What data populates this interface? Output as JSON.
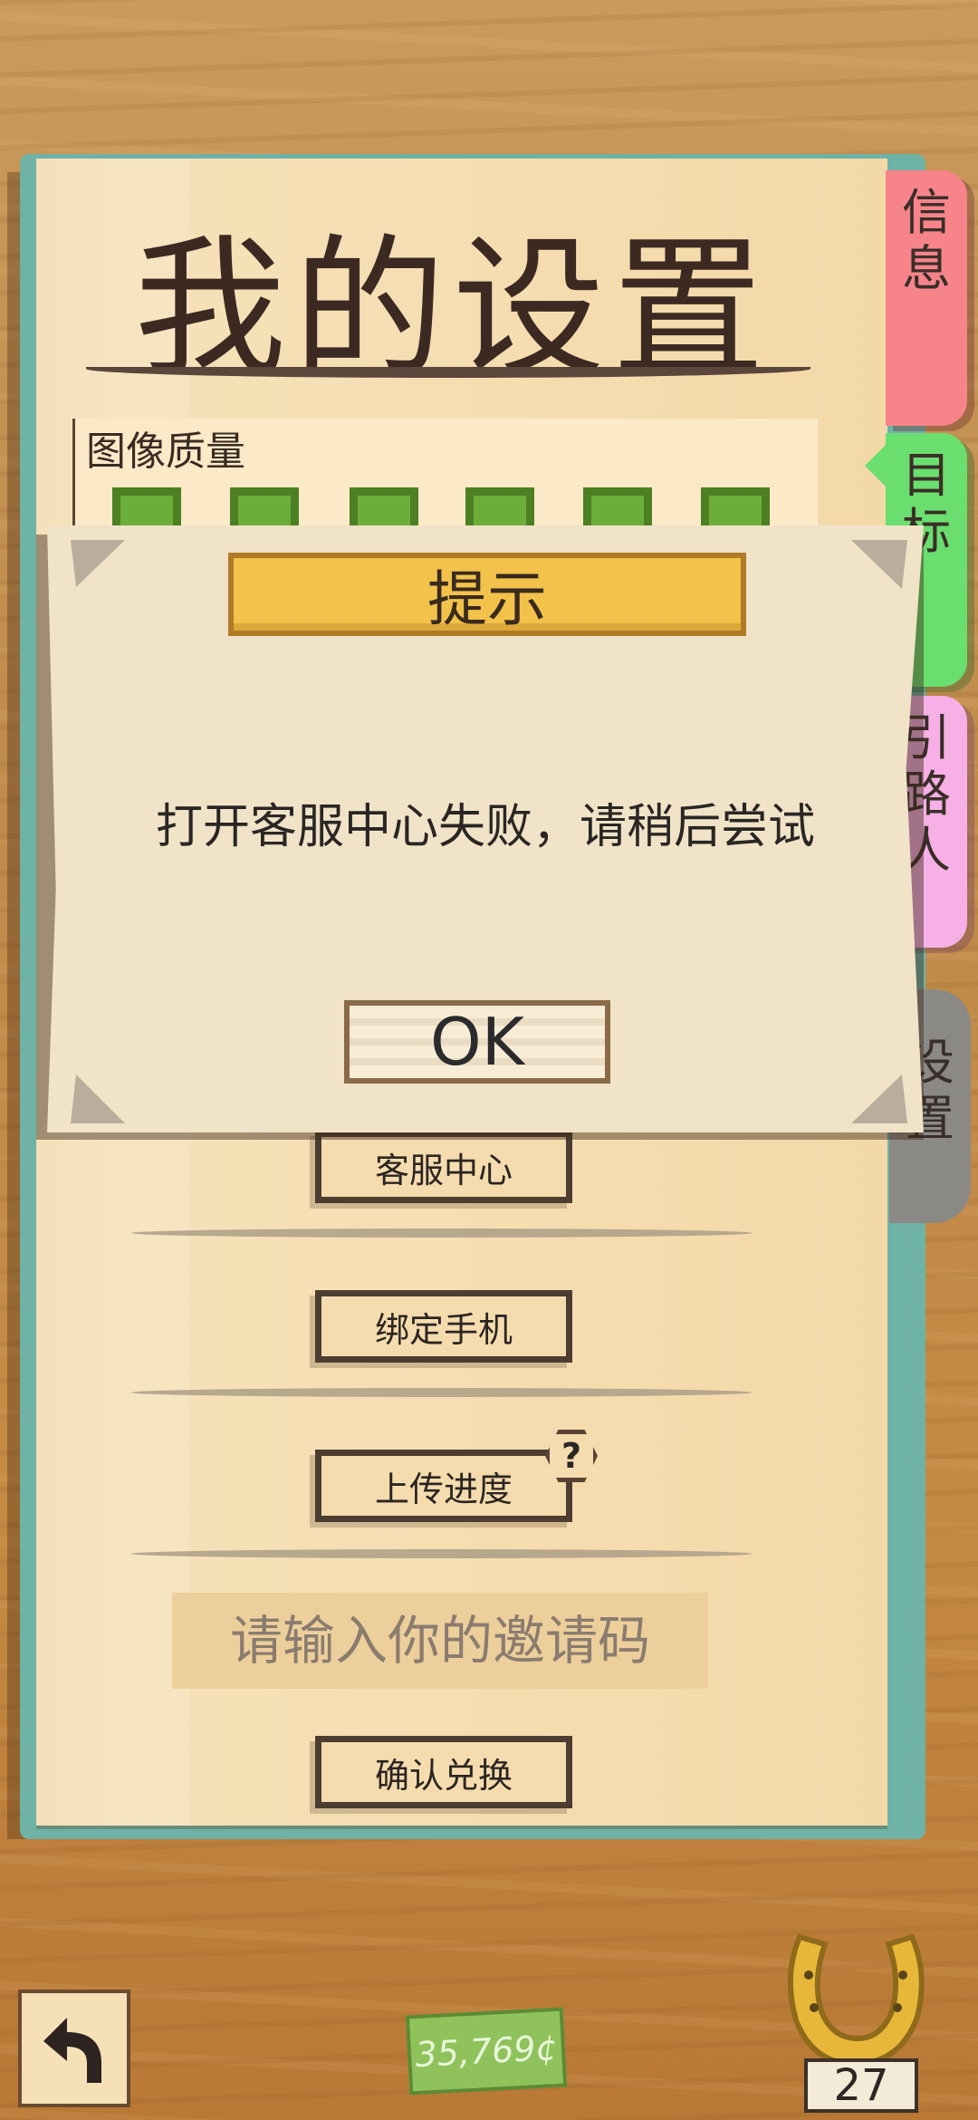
{
  "page": {
    "title": "我的设置"
  },
  "settings": {
    "quality_label": "图像质量",
    "quality_level": 6,
    "quality_max": 6
  },
  "tabs": {
    "info": "信息",
    "goal": "目标",
    "guide": "引路人",
    "settings": "设置"
  },
  "menu": {
    "customer_service": "客服中心",
    "bind_phone": "绑定手机",
    "upload_progress": "上传进度",
    "help_badge": "?",
    "invite_placeholder": "请输入你的邀请码",
    "confirm_redeem": "确认兑换"
  },
  "dialog": {
    "title": "提示",
    "message": "打开客服中心失败，请稍后尝试",
    "ok": "OK"
  },
  "bottom": {
    "coins": "35,769¢",
    "horseshoe_count": "27"
  },
  "icons": {
    "back": "back-arrow-icon",
    "horseshoe": "horseshoe-icon"
  }
}
